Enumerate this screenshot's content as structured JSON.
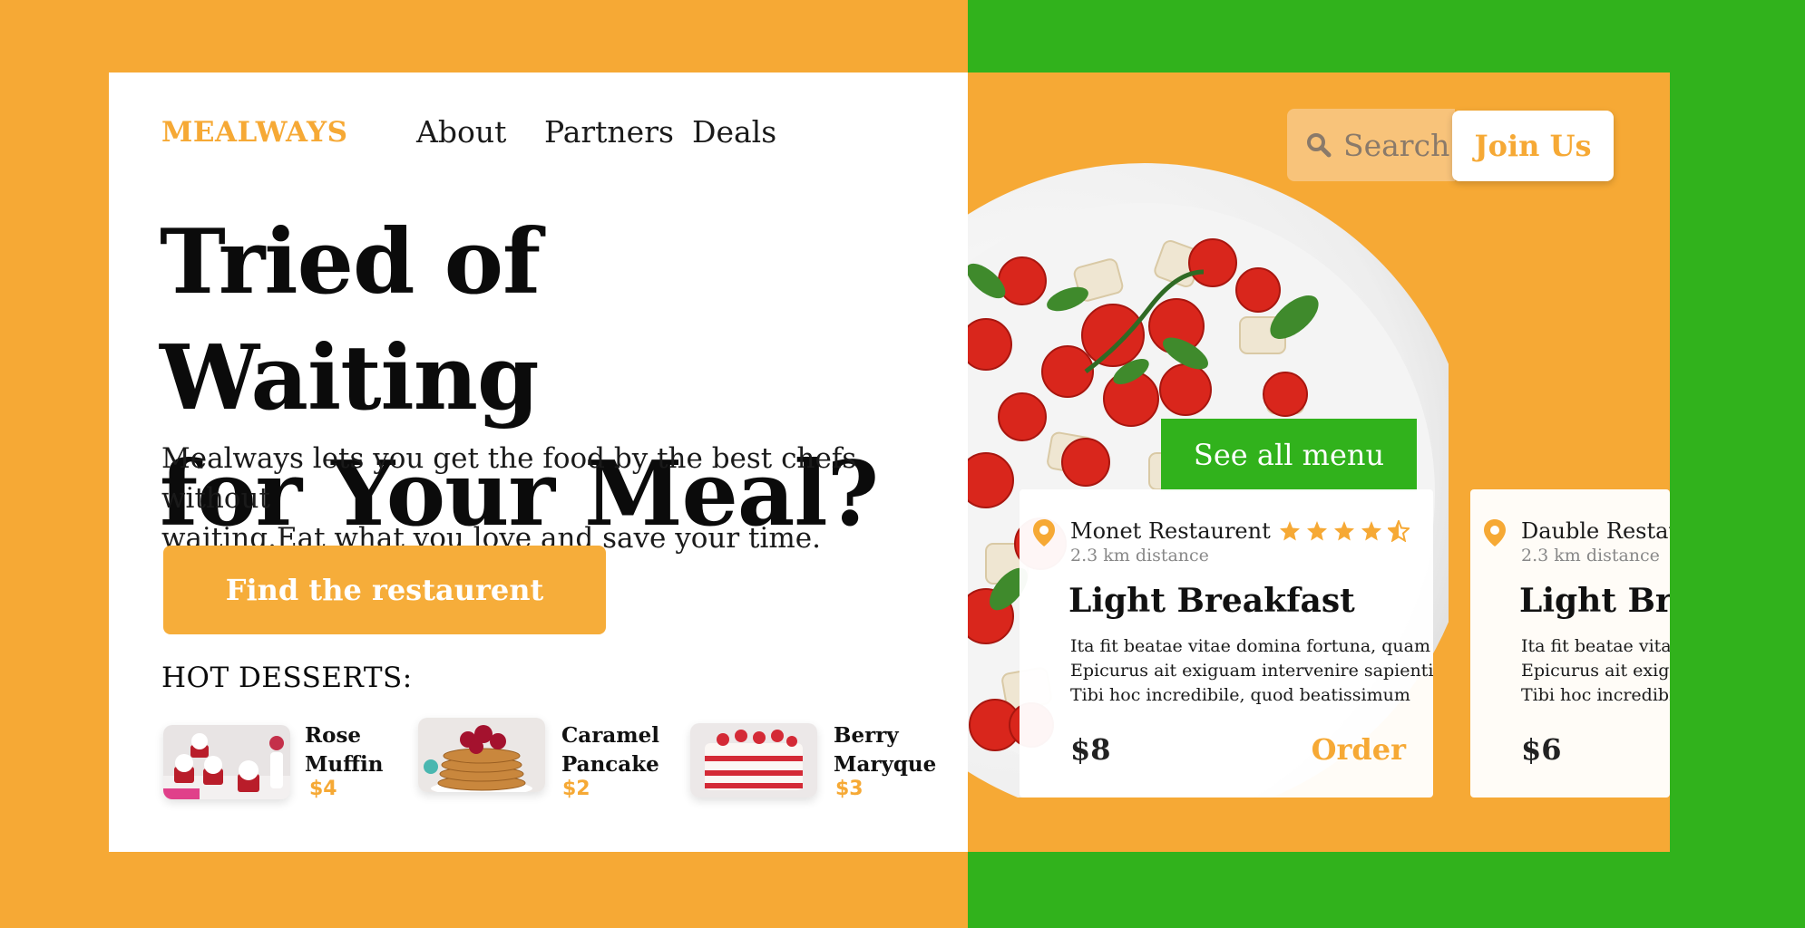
{
  "brand": {
    "logo": "MEALWAYS"
  },
  "nav": {
    "about": "About",
    "partners": "Partners",
    "deals": "Deals"
  },
  "search": {
    "label": "Search"
  },
  "join_label": "Join Us",
  "hero": {
    "headline_line1": "Tried of Waiting",
    "headline_line2": "for Your Meal?",
    "subtext_line1": "Mealways lets you get the food by the best chefs without",
    "subtext_line2": "waiting.Eat what you love and save your time.",
    "cta": "Find the restaurent"
  },
  "hot_desserts": {
    "title": "HOT DESSERTS:",
    "items": [
      {
        "name_line1": "Rose",
        "name_line2": "Muffin",
        "price": "$4"
      },
      {
        "name_line1": "Caramel",
        "name_line2": "Pancake",
        "price": "$2"
      },
      {
        "name_line1": "Berry",
        "name_line2": "Maryque",
        "price": "$3"
      }
    ]
  },
  "see_all_menu": "See all menu",
  "restaurants": [
    {
      "name": "Monet Restaurent",
      "distance": "2.3 km distance",
      "rating": 4.5,
      "meal": "Light Breakfast",
      "desc_line1": "Ita fit beatae vitae domina fortuna, quam",
      "desc_line2": "Epicurus ait exiguam intervenire sapienti.",
      "desc_line3": "Tibi hoc incredibile, quod beatissimum",
      "price": "$8",
      "order": "Order"
    },
    {
      "name": "Dauble Restau",
      "distance": "2.3 km distance",
      "meal": "Light Bre",
      "desc_line1": "Ita fit beatae vitae",
      "desc_line2": "Epicurus ait exigu",
      "desc_line3": "Tibi hoc incredibi",
      "price": "$6"
    }
  ],
  "colors": {
    "accent": "#f6a935",
    "green": "#31b21c",
    "text": "#0b0b0b"
  }
}
